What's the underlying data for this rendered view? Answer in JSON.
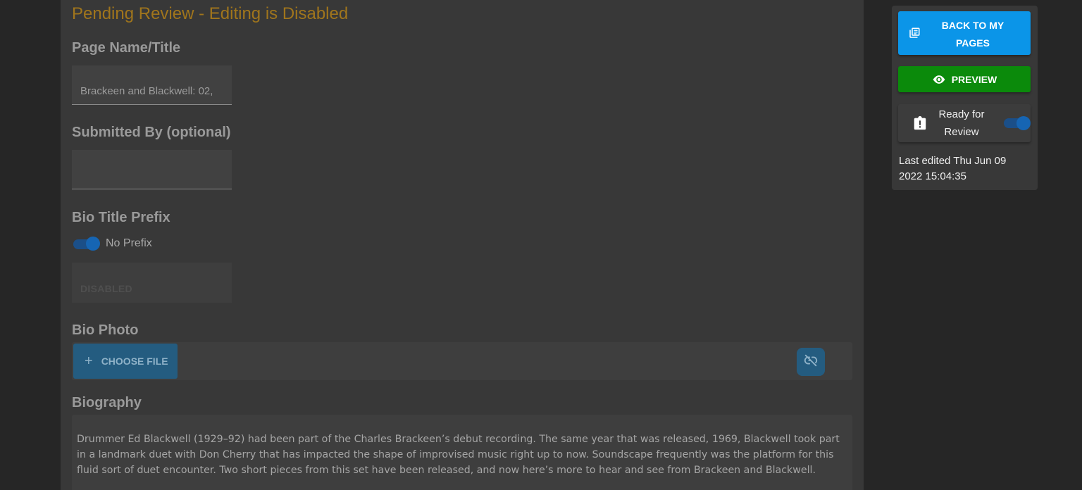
{
  "status": {
    "heading": "Pending Review - Editing is Disabled",
    "color": "#a0751c"
  },
  "form": {
    "page_name": {
      "label": "Page Name/Title",
      "value": "Brackeen and Blackwell: 02,"
    },
    "submitted_by": {
      "label": "Submitted By (optional)",
      "value": ""
    },
    "bio_title_prefix": {
      "label": "Bio Title Prefix",
      "toggle_label": "No Prefix",
      "toggle_on": true,
      "field_value": "DISABLED"
    },
    "bio_photo": {
      "label": "Bio Photo",
      "choose_file_label": "CHOOSE FILE",
      "plus_icon": "+",
      "unlink_icon": "link-off-icon"
    },
    "biography": {
      "label": "Biography",
      "text": "Drummer Ed Blackwell (1929–92) had been part of the Charles Brackeen’s debut recording. The same year that was released, 1969, Blackwell took part in a landmark duet with Don Cherry that has impacted the shape of improvised music right up to now. Soundscape frequently was the platform for this fluid sort of duet encounter. Two short pieces from this set have been released, and now here’s more to hear and see from Brackeen and Blackwell."
    }
  },
  "sidebar": {
    "back_button": {
      "label": "BACK TO MY PAGES",
      "icon": "pages-icon",
      "color": "#0b95e8"
    },
    "preview_button": {
      "label": "PREVIEW",
      "icon": "eye-icon",
      "color": "#0b8a0b"
    },
    "ready_for_review": {
      "label": "Ready for Review",
      "icon": "clipboard-alert-icon",
      "toggle_on": true
    },
    "last_edited": "Last edited Thu Jun 09 2022 15:04:35"
  }
}
